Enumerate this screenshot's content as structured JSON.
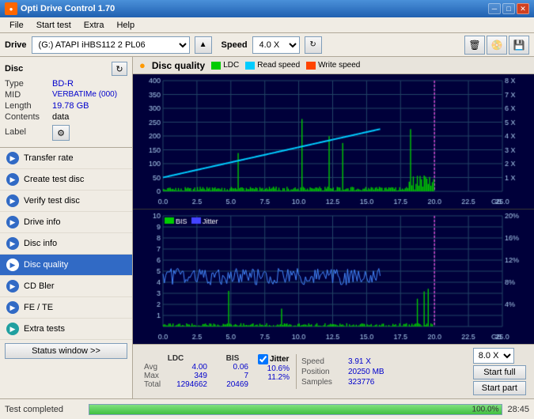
{
  "app": {
    "title": "Opti Drive Control 1.70",
    "icon": "💿"
  },
  "titlebar": {
    "minimize": "─",
    "maximize": "□",
    "close": "✕"
  },
  "menubar": {
    "items": [
      "File",
      "Start test",
      "Extra",
      "Help"
    ]
  },
  "drivebar": {
    "drive_label": "Drive",
    "drive_value": "(G:)  ATAPI iHBS112  2 PL06",
    "speed_label": "Speed",
    "speed_value": "4.0 X"
  },
  "disc": {
    "title": "Disc",
    "type_label": "Type",
    "type_value": "BD-R",
    "mid_label": "MID",
    "mid_value": "VERBATIMe (000)",
    "length_label": "Length",
    "length_value": "19.78 GB",
    "contents_label": "Contents",
    "contents_value": "data",
    "label_label": "Label",
    "label_value": ""
  },
  "chart": {
    "title": "Disc quality",
    "legend": {
      "ldc_label": "LDC",
      "ldc_color": "#00cc00",
      "read_speed_label": "Read speed",
      "read_speed_color": "#00ccff",
      "write_speed_label": "Write speed",
      "write_speed_color": "#ff4400",
      "bis_label": "BIS",
      "bis_color": "#00cc00",
      "jitter_label": "Jitter",
      "jitter_color": "#4444ff"
    },
    "top_y_max": 400,
    "top_y_right_max": "8 X",
    "bottom_y_max": 10,
    "bottom_y_right_max": "20%",
    "x_max": "25.0 GB",
    "x_marks": [
      "0.0",
      "2.5",
      "5.0",
      "7.5",
      "10.0",
      "12.5",
      "15.0",
      "17.5",
      "20.0",
      "22.5",
      "25.0"
    ]
  },
  "nav": {
    "items": [
      {
        "id": "transfer-rate",
        "label": "Transfer rate",
        "active": false
      },
      {
        "id": "create-test-disc",
        "label": "Create test disc",
        "active": false
      },
      {
        "id": "verify-test-disc",
        "label": "Verify test disc",
        "active": false
      },
      {
        "id": "drive-info",
        "label": "Drive info",
        "active": false
      },
      {
        "id": "disc-info",
        "label": "Disc info",
        "active": false
      },
      {
        "id": "disc-quality",
        "label": "Disc quality",
        "active": true
      },
      {
        "id": "cd-bler",
        "label": "CD Bler",
        "active": false
      },
      {
        "id": "fe-te",
        "label": "FE / TE",
        "active": false
      },
      {
        "id": "extra-tests",
        "label": "Extra tests",
        "active": false
      }
    ]
  },
  "stats": {
    "ldc_label": "LDC",
    "bis_label": "BIS",
    "jitter_label": "Jitter",
    "avg_label": "Avg",
    "max_label": "Max",
    "total_label": "Total",
    "ldc_avg": "4.00",
    "ldc_max": "349",
    "ldc_total": "1294662",
    "bis_avg": "0.06",
    "bis_max": "7",
    "bis_total": "20469",
    "jitter_avg": "10.6%",
    "jitter_max": "11.2%",
    "jitter_total": "",
    "speed_label": "Speed",
    "position_label": "Position",
    "samples_label": "Samples",
    "speed_value": "3.91 X",
    "position_value": "20250 MB",
    "samples_value": "323776",
    "speed_select": "8.0 X",
    "btn_start_full": "Start full",
    "btn_start_part": "Start part"
  },
  "statusbar": {
    "status_text": "Test completed",
    "progress_percent": 100,
    "progress_label": "100.0%",
    "time": "28:45"
  }
}
